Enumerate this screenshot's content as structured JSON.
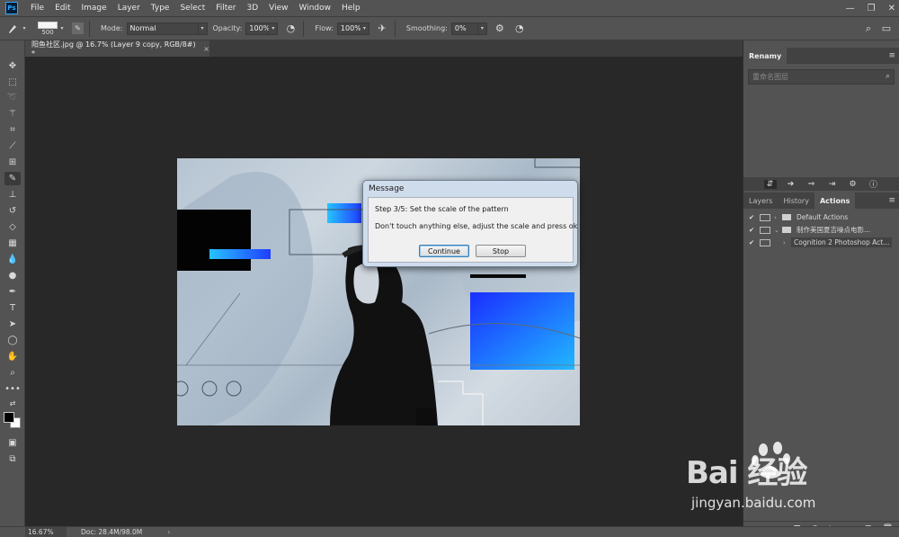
{
  "app": {
    "logo": "Ps"
  },
  "menu": [
    "File",
    "Edit",
    "Image",
    "Layer",
    "Type",
    "Select",
    "Filter",
    "3D",
    "View",
    "Window",
    "Help"
  ],
  "window_controls": [
    "—",
    "❐",
    "✕"
  ],
  "options": {
    "brush_size": "500",
    "mode_label": "Mode:",
    "mode_value": "Normal",
    "opacity_label": "Opacity:",
    "opacity_value": "100%",
    "flow_label": "Flow:",
    "flow_value": "100%",
    "smoothing_label": "Smoothing:",
    "smoothing_value": "0%"
  },
  "document_tab": {
    "title": "阳鱼社区.jpg @ 16.7% (Layer 9 copy, RGB/8#) *",
    "close": "×"
  },
  "dialog": {
    "title": "Message",
    "line1": "Step 3/5: Set the scale of the pattern",
    "line2": "Don't touch anything else, adjust the scale and press ok",
    "continue_label": "Continue",
    "stop_label": "Stop"
  },
  "renamy_panel": {
    "title": "Renamy",
    "search_placeholder": "重命名图层"
  },
  "actions_panel": {
    "tabs": [
      "Layers",
      "History",
      "Actions"
    ],
    "active_tab": "Actions",
    "rows": [
      {
        "label": "Default Actions",
        "type": "set"
      },
      {
        "label": "制作美国夏吉噪点电影...",
        "type": "set-open"
      },
      {
        "label": "Cognition 2 Photoshop Act...",
        "type": "action"
      }
    ]
  },
  "status": {
    "zoom": "16.67%",
    "doc": "Doc: 28.4M/98.0M"
  },
  "watermark": {
    "main": "Bai 经验",
    "sub": "jingyan.baidu.com"
  },
  "colors": {
    "accent_blue": "#1fb3ff",
    "deep_blue": "#1a3cff",
    "panel": "#535353",
    "canvas_bg": "#282828"
  }
}
